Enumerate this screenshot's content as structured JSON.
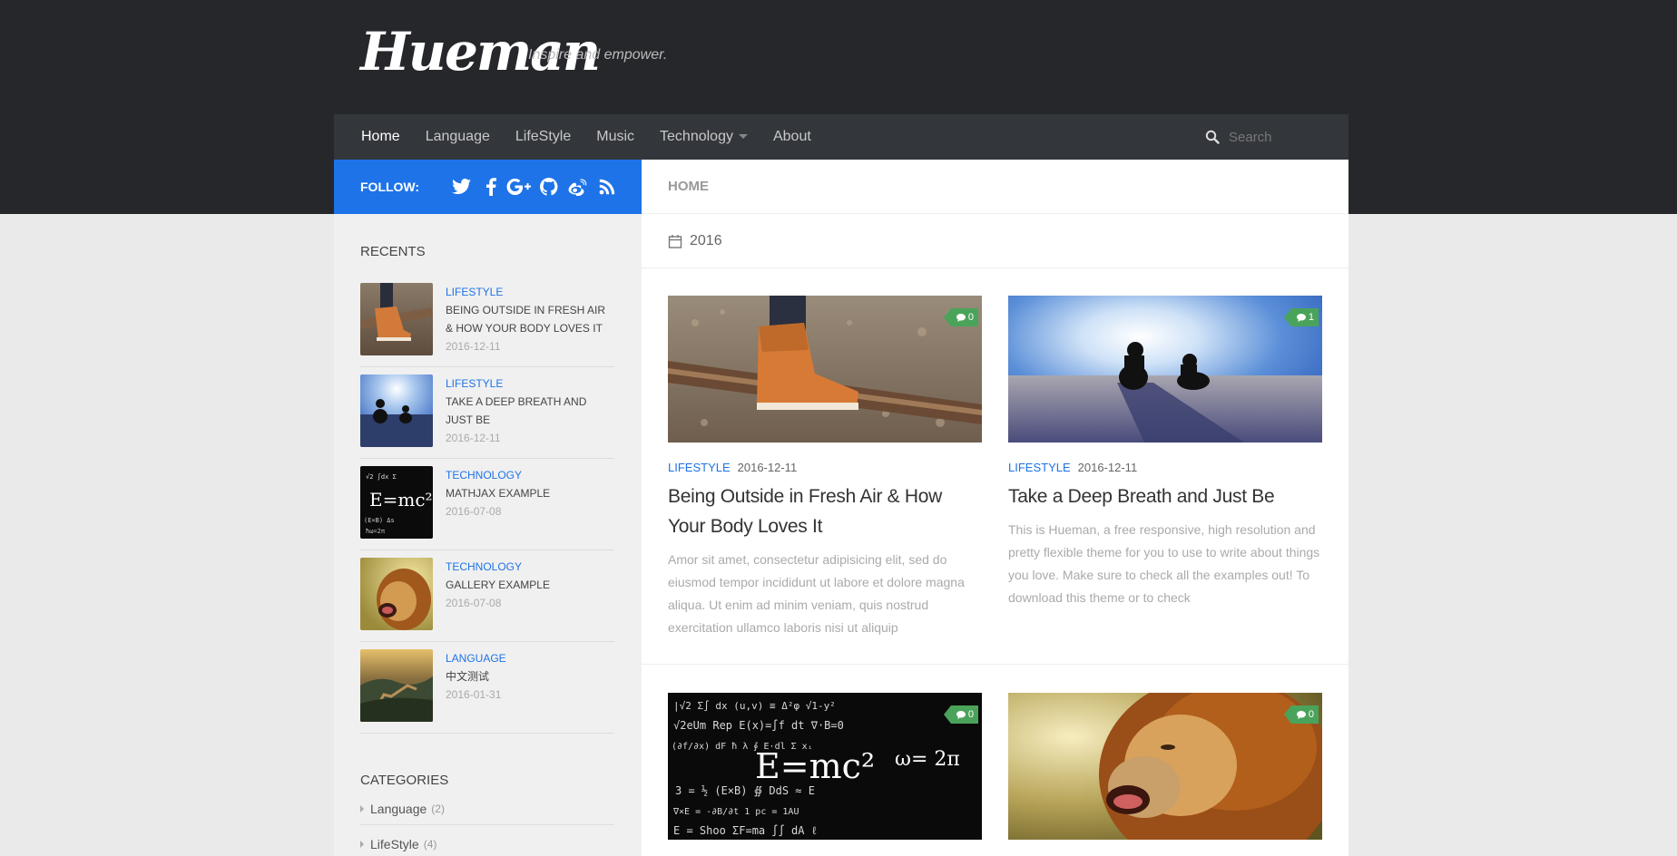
{
  "site": {
    "logo": "Hueman",
    "tagline": "Inspire and empower."
  },
  "nav": {
    "items": [
      {
        "label": "Home",
        "active": true
      },
      {
        "label": "Language"
      },
      {
        "label": "LifeStyle"
      },
      {
        "label": "Music"
      },
      {
        "label": "Technology",
        "has_dropdown": true
      },
      {
        "label": "About"
      }
    ],
    "search_placeholder": "Search"
  },
  "follow": {
    "label": "FOLLOW:",
    "icons": [
      "twitter-icon",
      "facebook-icon",
      "google-plus-icon",
      "github-icon",
      "weibo-icon",
      "rss-icon"
    ]
  },
  "recents": {
    "title": "RECENTS",
    "items": [
      {
        "category": "LIFESTYLE",
        "title": "BEING OUTSIDE IN FRESH AIR & HOW YOUR BODY LOVES IT",
        "date": "2016-12-11"
      },
      {
        "category": "LIFESTYLE",
        "title": "TAKE A DEEP BREATH AND JUST BE",
        "date": "2016-12-11"
      },
      {
        "category": "TECHNOLOGY",
        "title": "MATHJAX EXAMPLE",
        "date": "2016-07-08"
      },
      {
        "category": "TECHNOLOGY",
        "title": "GALLERY EXAMPLE",
        "date": "2016-07-08"
      },
      {
        "category": "LANGUAGE",
        "title": "中文测试",
        "date": "2016-01-31"
      }
    ]
  },
  "categories": {
    "title": "CATEGORIES",
    "items": [
      {
        "label": "Language",
        "count": "(2)"
      },
      {
        "label": "LifeStyle",
        "count": "(4)"
      }
    ]
  },
  "breadcrumb": "HOME",
  "archive_label": "2016",
  "posts": [
    {
      "category": "LIFESTYLE",
      "date": "2016-12-11",
      "comments": "0",
      "title": "Being Outside in Fresh Air & How Your Body Loves It",
      "excerpt": "Amor sit amet, consectetur adipisicing elit, sed do eiusmod tempor incididunt ut labore et dolore magna aliqua. Ut enim ad minim veniam, quis nostrud exercitation ullamco laboris nisi ut aliquip"
    },
    {
      "category": "LIFESTYLE",
      "date": "2016-12-11",
      "comments": "1",
      "title": "Take a Deep Breath and Just Be",
      "excerpt": "This is Hueman, a free responsive, high resolution and pretty flexible theme for you to use to write about things you love. Make sure to check all the examples out! To download this theme or to check"
    },
    {
      "comments": "0"
    },
    {
      "comments": "0"
    }
  ],
  "colors": {
    "header_bg": "#26272b",
    "nav_bg": "#33363b",
    "accent_blue": "#1e73e8",
    "comment_badge": "#4aa35a"
  }
}
